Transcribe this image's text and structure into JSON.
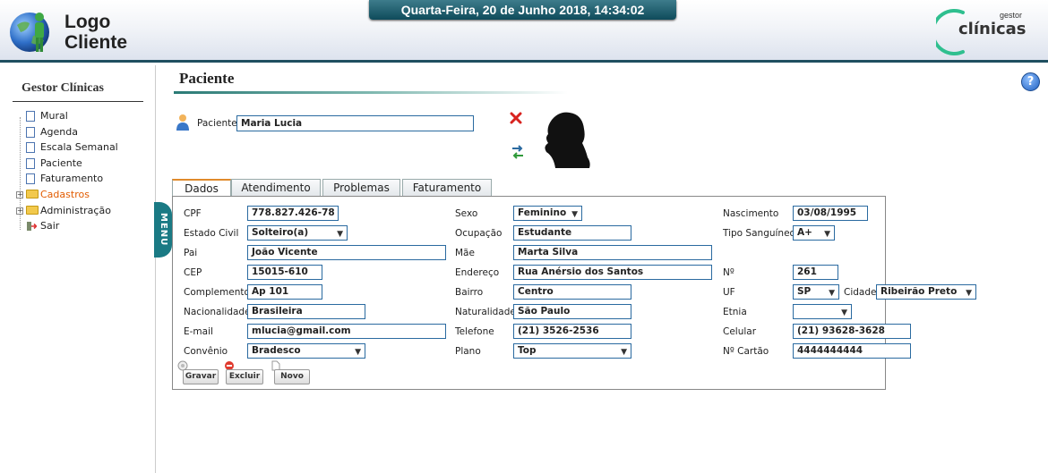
{
  "header": {
    "logo_line1": "Logo",
    "logo_line2": "Cliente",
    "datetime": "Quarta-Feira, 20 de Junho 2018, 14:34:02",
    "brand_small": "gestor",
    "brand_big": "clínicas"
  },
  "colors": {
    "accent_teal": "#1f4f60",
    "brand_green": "#2fbf8f",
    "field_border": "#2a6aa0",
    "active_orange": "#e25b00",
    "tab_active_top": "#e08a2c"
  },
  "sidebar": {
    "title": "Gestor Clínicas",
    "items": [
      {
        "label": "Mural",
        "icon": "document-icon"
      },
      {
        "label": "Agenda",
        "icon": "document-icon"
      },
      {
        "label": "Escala Semanal",
        "icon": "document-icon"
      },
      {
        "label": "Paciente",
        "icon": "document-icon"
      },
      {
        "label": "Faturamento",
        "icon": "document-icon"
      },
      {
        "label": "Cadastros",
        "icon": "folder-icon",
        "active": true
      },
      {
        "label": "Administração",
        "icon": "folder-icon"
      },
      {
        "label": "Sair",
        "icon": "exit-icon"
      }
    ],
    "menu_tab": "MENU"
  },
  "main": {
    "title": "Paciente",
    "help": "?",
    "patient_label": "Paciente",
    "patient_value": "Maria Lucia",
    "tabs": [
      "Dados",
      "Atendimento",
      "Problemas",
      "Faturamento"
    ],
    "active_tab": "Dados"
  },
  "form": {
    "cpf": {
      "label": "CPF",
      "value": "778.827.426-78"
    },
    "sexo": {
      "label": "Sexo",
      "value": "Feminino"
    },
    "nascimento": {
      "label": "Nascimento",
      "value": "03/08/1995"
    },
    "estado_civil": {
      "label": "Estado Civil",
      "value": "Solteiro(a)"
    },
    "ocupacao": {
      "label": "Ocupação",
      "value": "Estudante"
    },
    "tipo_sanguineo": {
      "label": "Tipo Sanguíneo",
      "value": "A+"
    },
    "pai": {
      "label": "Pai",
      "value": "João Vicente"
    },
    "mae": {
      "label": "Mãe",
      "value": "Marta Silva"
    },
    "cep": {
      "label": "CEP",
      "value": "15015-610"
    },
    "endereco": {
      "label": "Endereço",
      "value": "Rua Anérsio dos Santos"
    },
    "numero": {
      "label": "Nº",
      "value": "261"
    },
    "complemento": {
      "label": "Complemento",
      "value": "Ap 101"
    },
    "bairro": {
      "label": "Bairro",
      "value": "Centro"
    },
    "uf": {
      "label": "UF",
      "value": "SP"
    },
    "cidade": {
      "label": "Cidade",
      "value": "Ribeirão Preto"
    },
    "nacionalidade": {
      "label": "Nacionalidade",
      "value": "Brasileira"
    },
    "naturalidade": {
      "label": "Naturalidade",
      "value": "São Paulo"
    },
    "etnia": {
      "label": "Etnia",
      "value": ""
    },
    "email": {
      "label": "E-mail",
      "value": "mlucia@gmail.com"
    },
    "telefone": {
      "label": "Telefone",
      "value": "(21) 3526-2536"
    },
    "celular": {
      "label": "Celular",
      "value": "(21) 93628-3628"
    },
    "convenio": {
      "label": "Convênio",
      "value": "Bradesco"
    },
    "plano": {
      "label": "Plano",
      "value": "Top"
    },
    "cartao": {
      "label": "Nº Cartão",
      "value": "4444444444"
    }
  },
  "buttons": {
    "gravar": "Gravar",
    "excluir": "Excluir",
    "novo": "Novo"
  }
}
